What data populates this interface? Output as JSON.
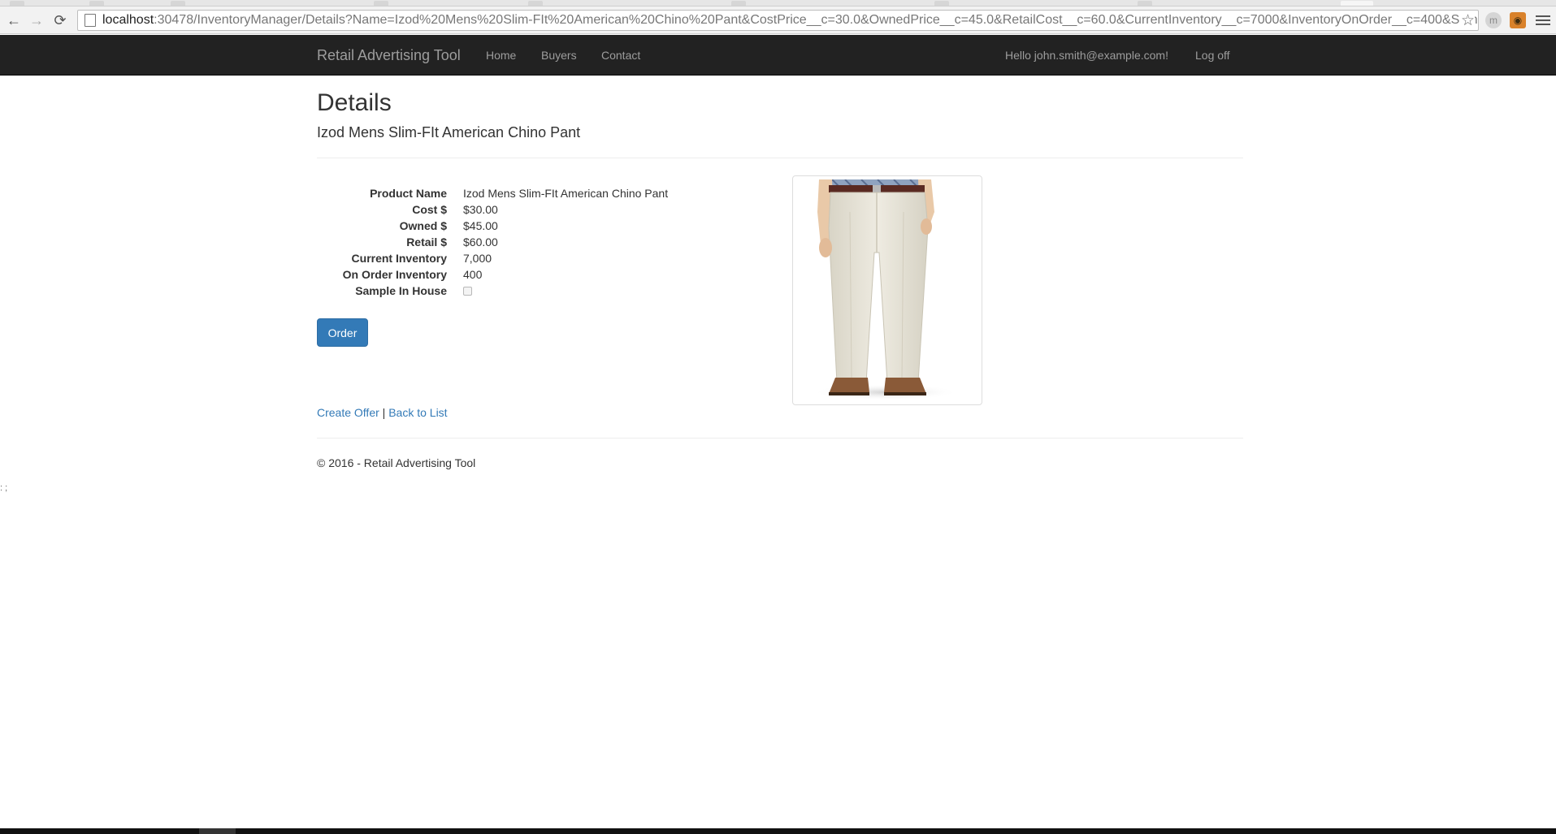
{
  "browser": {
    "url_host": "localhost",
    "url_path": ":30478/InventoryManager/Details?Name=Izod%20Mens%20Slim-FIt%20American%20Chino%20Pant&CostPrice__c=30.0&OwnedPrice__c=45.0&RetailCost__c=60.0&CurrentInventory__c=7000&InventoryOnOrder__c=400&Sample",
    "back_icon": "arrow-left",
    "forward_icon": "arrow-right",
    "reload_icon": "reload",
    "bookmark_icon": "star",
    "extension_1": "m",
    "extension_2": "owl",
    "menu_icon": "hamburger"
  },
  "navbar": {
    "brand": "Retail Advertising Tool",
    "links": [
      "Home",
      "Buyers",
      "Contact"
    ],
    "greeting": "Hello john.smith@example.com!",
    "logoff": "Log off"
  },
  "page": {
    "title": "Details",
    "subtitle": "Izod Mens Slim-FIt American Chino Pant"
  },
  "details": {
    "fields": [
      {
        "label": "Product Name",
        "value": "Izod Mens Slim-FIt American Chino Pant"
      },
      {
        "label": "Cost $",
        "value": "$30.00"
      },
      {
        "label": "Owned $",
        "value": "$45.00"
      },
      {
        "label": "Retail $",
        "value": "$60.00"
      },
      {
        "label": "Current Inventory",
        "value": "7,000"
      },
      {
        "label": "On Order Inventory",
        "value": "400"
      },
      {
        "label": "Sample In House",
        "value": ""
      }
    ],
    "sample_in_house": false
  },
  "actions": {
    "order_label": "Order",
    "create_offer": "Create Offer",
    "separator": "|",
    "back_to_list": "Back to List"
  },
  "footer": {
    "text": "© 2016 - Retail Advertising Tool"
  },
  "stray_text": ": ;",
  "colors": {
    "navbar_bg": "#222222",
    "link": "#337ab7",
    "button": "#337ab7"
  }
}
